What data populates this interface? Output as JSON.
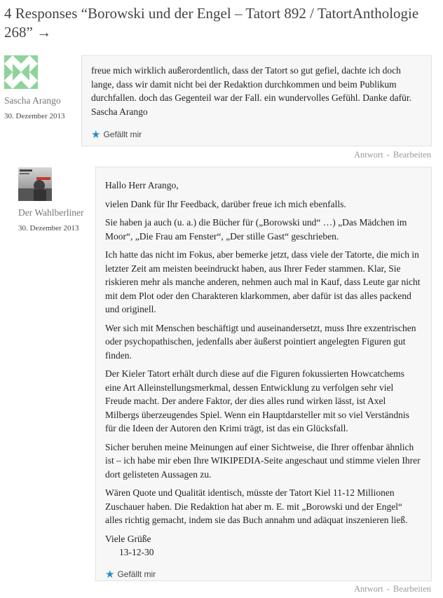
{
  "heading": "4 Responses “Borowski und der Engel – Tatort 892 / TatortAnthologie 268” →",
  "comments": [
    {
      "author": "Sascha Arango",
      "date": "30. Dezember 2013",
      "avatar_icon": "identicon-avatar-icon",
      "paragraphs": [
        "freue mich wirklich außerordentlich, dass der Tatort so gut gefiel, dachte ich doch lange, dass wir damit nicht bei der Redaktion durchkommen und beim Publikum durchfallen. doch das Gegenteil war der Fall. ein wundervolles Gefühl. Danke dafür. Sascha Arango"
      ],
      "like": "Gefällt mir",
      "reply": "Antwort",
      "edit": "Bearbeiten"
    },
    {
      "author": "Der Wahlberliner",
      "date": "30. Dezember 2013",
      "avatar_icon": "photo-avatar-icon",
      "avatar_text": "Der Wahlberliner",
      "paragraphs": [
        "Hallo Herr Arango,",
        "vielen Dank für Ihr Feedback, darüber freue ich mich ebenfalls.",
        "Sie haben ja auch (u. a.) die Bücher für („Borowski und“ …) „Das Mädchen im Moor“, „Die Frau am Fenster“, „Der stille Gast“ geschrieben.",
        "Ich hatte das nicht im Fokus, aber bemerke jetzt, dass viele der Tatorte, die mich in letzter Zeit am meisten beeindruckt haben, aus Ihrer Feder stammen. Klar, Sie riskieren mehr als manche anderen, nehmen auch mal in Kauf, dass Leute gar nicht mit dem Plot oder den Charakteren klarkommen, aber dafür ist das alles packend und originell.",
        "Wer sich mit Menschen beschäftigt und auseinandersetzt, muss Ihre exzentrischen oder psychopathischen, jedenfalls aber äußerst pointiert angelegten Figuren gut finden.",
        "Der Kieler Tatort erhält durch diese auf die Figuren fokussierten Howcatchems eine Art Alleinstellungsmerkmal, dessen Entwicklung zu verfolgen sehr viel Freude macht. Der andere Faktor, der dies alles rund wirken lässt, ist Axel Milbergs überzeugendes Spiel. Wenn ein Hauptdarsteller mit so viel Verständnis für die Ideen der Autoren den Krimi trägt, ist das ein Glücksfall.",
        "Sicher beruhen meine Meinungen auf einer Sichtweise, die Ihrer offenbar ähnlich ist – ich habe mir eben Ihre WIKIPEDIA-Seite angeschaut und stimme vielen Ihrer dort gelisteten Aussagen zu.",
        "Wären Quote und Qualität identisch, müsste der Tatort Kiel 11-12 Millionen Zuschauer haben. Die Redaktion hat aber m. E. mit „Borowski und der Engel“ alles richtig gemacht, indem sie das Buch annahm und adäquat inszenieren ließ."
      ],
      "signoff": "Viele Grüße",
      "signoff_date": "13-12-30",
      "like": "Gefällt mir",
      "reply": "Antwort",
      "edit": "Bearbeiten"
    }
  ],
  "colors": {
    "star": "#2b8bc4",
    "box_bg": "#f7f7f7",
    "meta": "#9a9a9a"
  }
}
